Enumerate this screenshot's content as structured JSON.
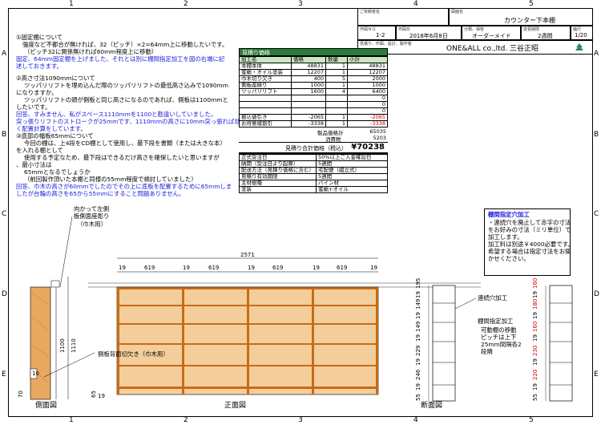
{
  "grid": {
    "cols": [
      "1",
      "2",
      "3",
      "4",
      "5"
    ],
    "rows": [
      "A",
      "B",
      "C",
      "D",
      "E"
    ]
  },
  "title_block": {
    "customer_label": "ご依頼者名",
    "drawing_name_label": "図面名",
    "drawing_name": "カウンター下本棚",
    "work_no_label": "作図ＮＯ",
    "work_no": "1-2",
    "date_label": "作図日",
    "date": "2018年6月8日",
    "category_label": "分類、保管",
    "category": "オーダーメイド",
    "period_label": "変更期限",
    "period": "2週間",
    "scale_label": "縮尺",
    "scale": "1/20",
    "maker_label": "見積り、作図、設計、製作者",
    "maker": "ONE&ALL co.,ltd.  三谷正昭"
  },
  "notes": {
    "n1_title": "①固定棚について",
    "n1_l1": "強度など不都合が無ければ、32（ピッチ）×2=64mm上に移動したいです。",
    "n1_l2": "（ピッチ32に関係無ければ60mm程度上に移動）",
    "n1_ans1": "固定、64mm固定棚を上げました、それとは別に棚間指定加工を図の右端に記",
    "n1_ans2": "述しておきます。",
    "n2_title": "②高さ寸法1090mmについて",
    "n2_l1": "ツッパリリフトを埋め込んだ際のツッパリリフトの最低高さ込みで1090mm",
    "n2_l2": "になりますか。",
    "n2_l3": "ツッパリリフトの頭が側板と同じ高さになるのであれば、側板は1100mmと",
    "n2_l4": "したいです。",
    "n2_ans1": "回答、すみません、私がスペース1110mmを1100と勘違いしていました。",
    "n2_ans2": "突っ張りリフトのストロークが25mmです、1110mmの高さに10mm突っ張れば効",
    "n2_ans3": "く配置計算をしています。",
    "n3_title": "③底部の幅板65mmについて",
    "n3_l1": "今回の棚は、上4段をCD棚として使用し、最下段を書類（または大きな本）",
    "n3_l2": "を入れる棚として",
    "n3_l3": "使用する予定なため、最下段はできるだけ高さを確保したいと思いますが",
    "n3_l4": "、最小寸法は",
    "n3_l5": "65mmとなるでしょうか",
    "n3_l6": "（前回製作頂いた本棚と同様の55mm程度で検討していました）",
    "n3_ans1": "回答、巾木の高さが60mmでしたのでその上に底板を配置するために65mmしま",
    "n3_ans2": "したが台輪の高さを65から55mmにすること問題ありません。"
  },
  "estimate": {
    "title": "見積り価格",
    "headers": [
      "加工名",
      "価格",
      "数量",
      "小計"
    ],
    "rows": [
      [
        "本棚本体",
        "48831",
        "1",
        "48831"
      ],
      [
        "蜜蝋・オイル塗装",
        "12207",
        "1",
        "12207"
      ],
      [
        "巾木切り欠き",
        "400",
        "5",
        "2000"
      ],
      [
        "側板座繰り",
        "1000",
        "1",
        "1000"
      ],
      [
        "ツッパリリフト",
        "1600",
        "4",
        "6400"
      ],
      [
        "",
        "",
        "",
        "0"
      ],
      [
        "",
        "",
        "",
        "0"
      ],
      [
        "",
        "",
        "",
        "0"
      ],
      [
        "振込値引き",
        "-2065",
        "1",
        "-2065"
      ],
      [
        "お得意様割引",
        "-3338",
        "1",
        "-3338"
      ]
    ],
    "product_total_label": "製品価格計",
    "product_total": "65035",
    "tax_label": "消費税",
    "tax": "5203",
    "grand_label": "見積り合計価格（税込）",
    "grand_total": "¥70238",
    "spec": [
      [
        "正式受注日",
        "50%以上ご入金確認日"
      ],
      [
        "納期（受注日より起算）",
        "5週間"
      ],
      [
        "配送方法（見積り価格に含む）",
        "宅配便（組立式）"
      ],
      [
        "見積り有効期限",
        "5週間"
      ],
      [
        "主材樹種",
        "パイン材"
      ],
      [
        "塗装",
        "蜜蝋+オイル"
      ]
    ]
  },
  "drawing": {
    "side_label_1": "向かって左側",
    "side_label_2": "板側面座彫り",
    "side_label_3": "（巾木用）",
    "notch_label": "側板背面切欠き（巾木用）",
    "side_title": "側面図",
    "front_title": "正面図",
    "section_title": "断面図",
    "total_width": "2571",
    "bay_widths": [
      "19",
      "619",
      "19",
      "619",
      "19",
      "619",
      "19",
      "619",
      "19"
    ],
    "h1100": "1100",
    "h1110": "1110",
    "d10": "10",
    "d70": "70",
    "d65": "65",
    "d55": "55",
    "d19": "19",
    "hole_label": "連続穴加工",
    "shelf_label_1": "棚間指定加工",
    "shelf_label_2": "可動棚の移動",
    "shelf_label_3": "ピッチは上下",
    "shelf_label_4": "25mm間隔各2",
    "shelf_label_5": "段隣",
    "box_title": "棚間指定穴加工",
    "box_l1": "・連続穴を廃止して赤字の寸法",
    "box_l2": "をお好みの寸法（ミリ単位）で",
    "box_l3": "加工します。",
    "box_l4": "加工料は別途￥4000必要です。",
    "box_l5": "希望する場合は指定寸法をお聞",
    "box_l6": "かせください。",
    "sec1": [
      "55",
      "19",
      "246",
      "19",
      "229",
      "19",
      "149",
      "19",
      "149",
      "19",
      "195"
    ],
    "sec2": [
      "55",
      "19",
      "220",
      "19",
      "230",
      "19",
      "160",
      "19",
      "180",
      "19",
      "160"
    ]
  }
}
